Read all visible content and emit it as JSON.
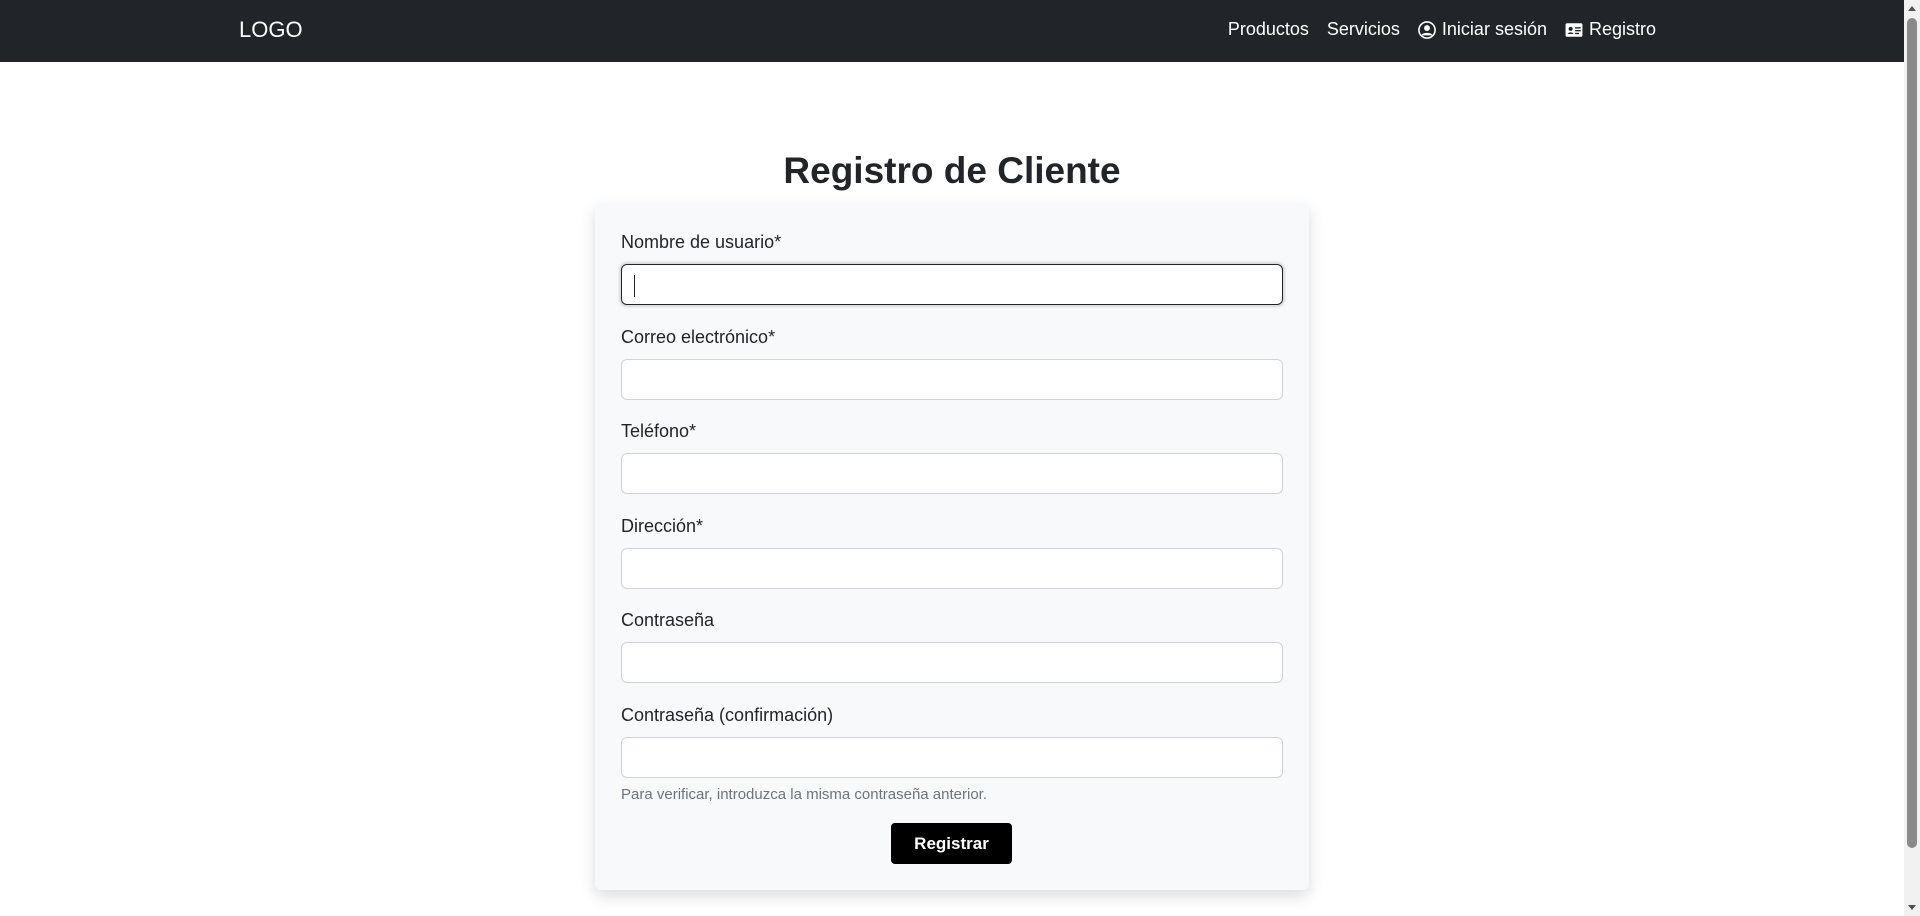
{
  "navbar": {
    "logo": "LOGO",
    "links": [
      {
        "label": "Productos",
        "icon": null
      },
      {
        "label": "Servicios",
        "icon": null
      },
      {
        "label": "Iniciar sesión",
        "icon": "user-circle-icon"
      },
      {
        "label": "Registro",
        "icon": "id-card-icon"
      }
    ]
  },
  "page": {
    "title": "Registro de Cliente"
  },
  "form": {
    "fields": [
      {
        "label": "Nombre de usuario*",
        "value": "",
        "placeholder": ""
      },
      {
        "label": "Correo electrónico*",
        "value": "",
        "placeholder": ""
      },
      {
        "label": "Teléfono*",
        "value": "",
        "placeholder": ""
      },
      {
        "label": "Dirección*",
        "value": "",
        "placeholder": ""
      },
      {
        "label": "Contraseña",
        "value": "",
        "placeholder": ""
      },
      {
        "label": "Contraseña (confirmación)",
        "value": "",
        "placeholder": "",
        "help": "Para verificar, introduzca la misma contraseña anterior."
      }
    ],
    "submit_label": "Registrar"
  },
  "colors": {
    "navbar_bg": "#212529",
    "card_bg": "#f8f9fa",
    "button_bg": "#000000"
  }
}
